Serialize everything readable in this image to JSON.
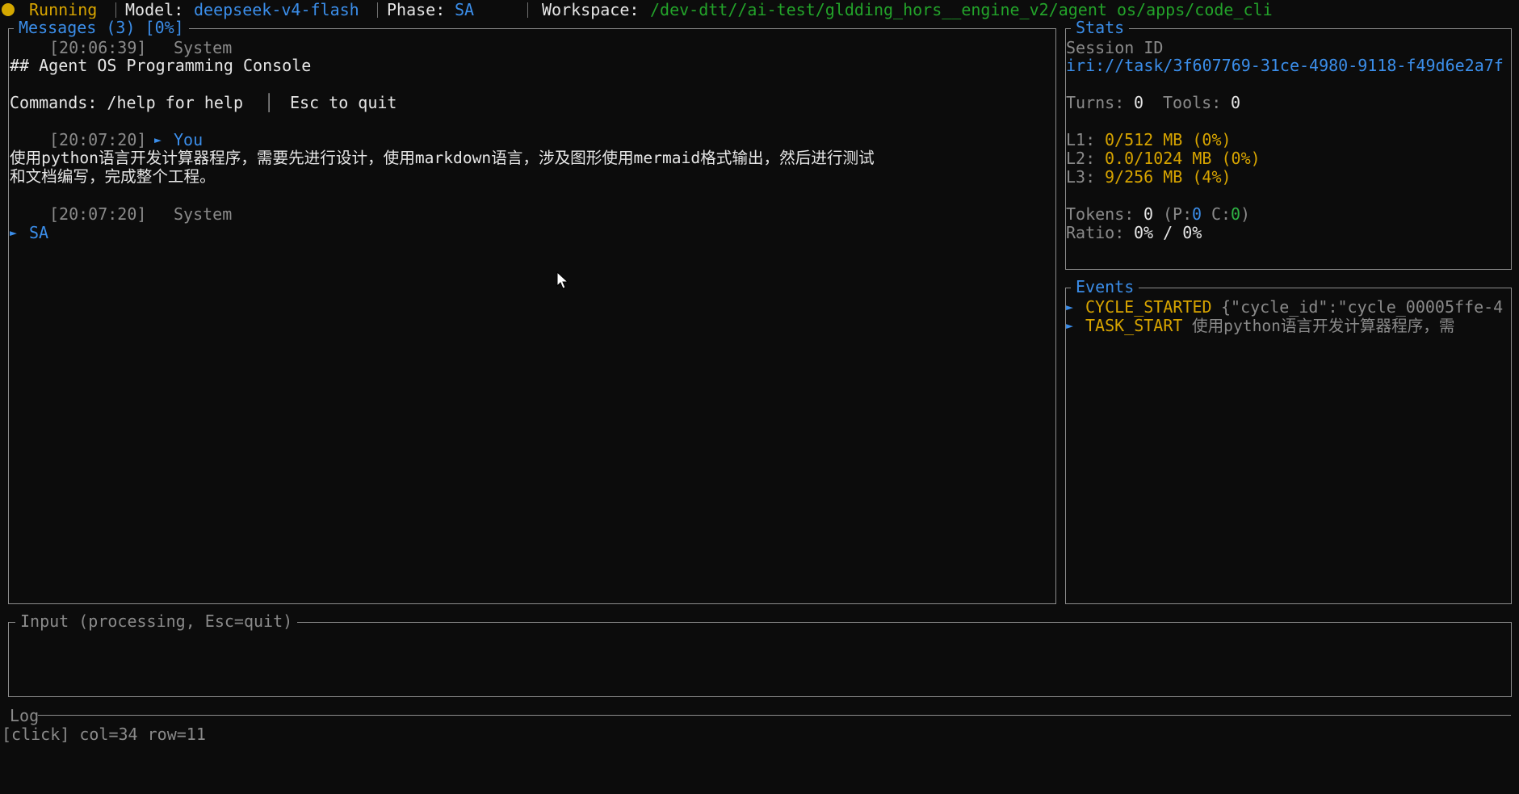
{
  "topbar": {
    "status": "Running",
    "model_label": "Model:",
    "model_value": "deepseek-v4-flash",
    "phase_label": "Phase:",
    "phase_value": "SA",
    "workspace_label": "Workspace:",
    "workspace_value": "/dev-dtt//ai-test/gldding_hors__engine_v2/agent_os/apps/code_cli"
  },
  "messages": {
    "title": "Messages (3) [0%]",
    "items": [
      {
        "timestamp": "[20:06:39]",
        "sender": "System",
        "lines": [
          "## Agent OS Programming Console",
          "",
          "Commands: /help for help"
        ],
        "commands_suffix": "Esc to quit"
      },
      {
        "timestamp": "[20:07:20]",
        "arrow": "►",
        "sender": "You",
        "lines": [
          "使用python语言开发计算器程序，需要先进行设计，使用markdown语言，涉及图形使用mermaid格式输出，然后进行测试",
          "和文档编写，完成整个工程。"
        ]
      },
      {
        "timestamp": "[20:07:20]",
        "sender": "System",
        "arrow": "►",
        "body": "SA"
      }
    ]
  },
  "stats": {
    "title": "Stats",
    "session_label": "Session ID",
    "session_value": "iri://task/3f607769-31ce-4980-9118-f49d6e2a7f",
    "turns_label": "Turns:",
    "turns_value": "0",
    "tools_label": "Tools:",
    "tools_value": "0",
    "l1_label": "L1:",
    "l1_value": "0/512 MB (0%)",
    "l2_label": "L2:",
    "l2_value": "0.0/1024 MB (0%)",
    "l3_label": "L3:",
    "l3_value": "9/256 MB (4%)",
    "tokens_label": "Tokens:",
    "tokens_value": "0",
    "tokens_p_label": "(P:",
    "tokens_p_value": "0",
    "tokens_c_label": "C:",
    "tokens_c_value": "0",
    "tokens_close": ")",
    "ratio_label": "Ratio:",
    "ratio_value": "0% / 0%"
  },
  "events": {
    "title": "Events",
    "items": [
      {
        "arrow": "►",
        "name": "CYCLE_STARTED",
        "detail": "{\"cycle_id\":\"cycle_00005ffe-4"
      },
      {
        "arrow": "►",
        "name": "TASK_START",
        "detail": "使用python语言开发计算器程序，需"
      }
    ]
  },
  "input": {
    "title": "Input (processing, Esc=quit)",
    "value": ""
  },
  "log": {
    "title": "Log",
    "lines": [
      "[click] col=34 row=11"
    ]
  },
  "colors": {
    "background": "#0c0c0c",
    "accent_blue": "#3b8eea",
    "accent_yellow": "#d7a400",
    "accent_green": "#2fb344",
    "border": "#8c8c8c"
  }
}
